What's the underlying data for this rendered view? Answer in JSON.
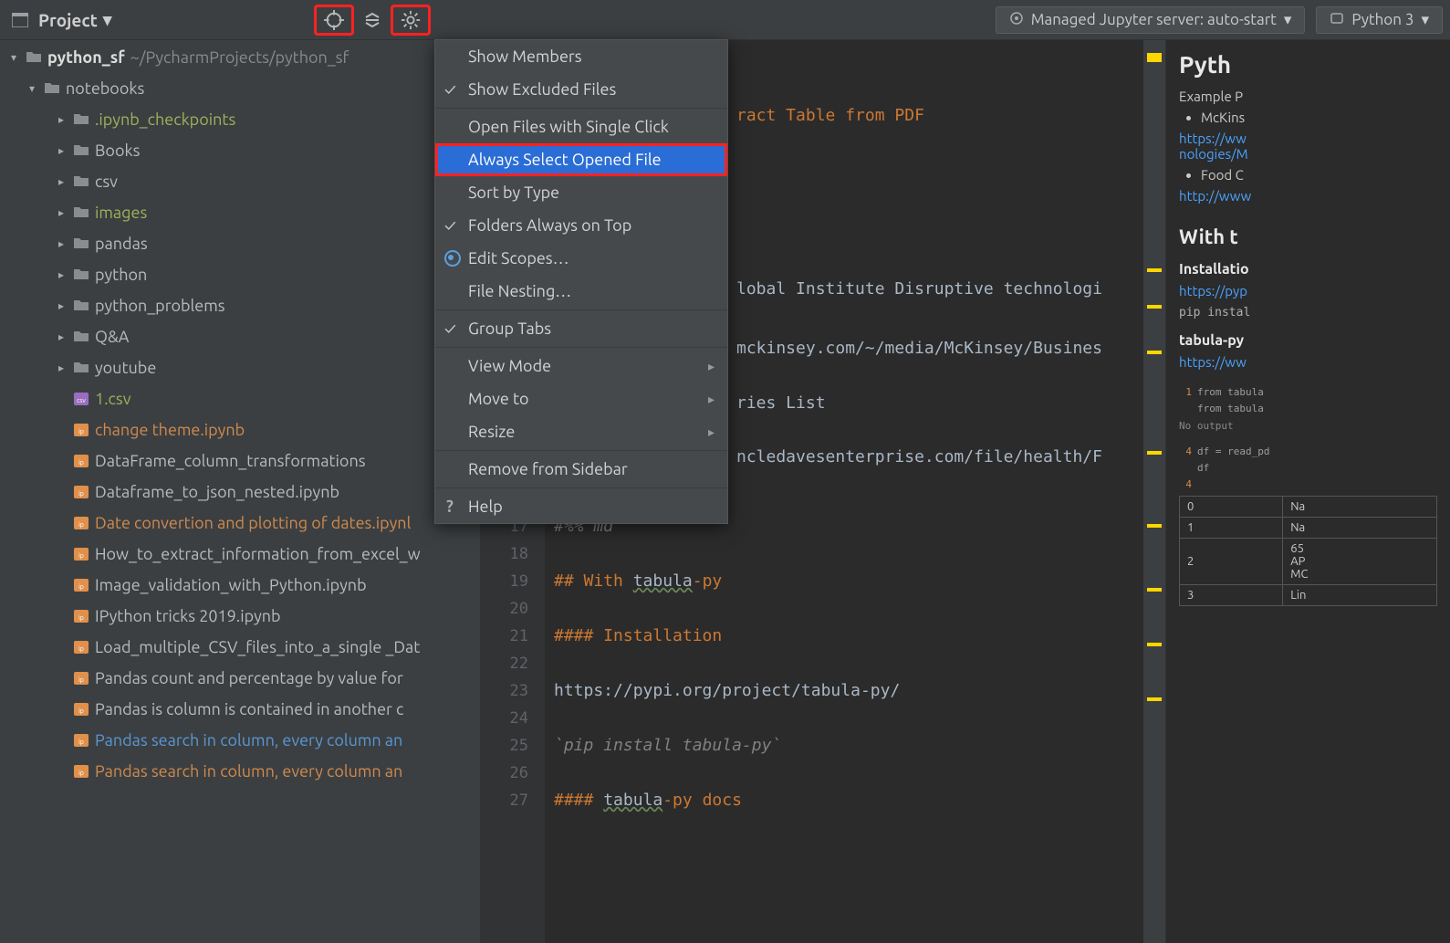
{
  "toolbar": {
    "project_label": "Project",
    "jupyter_label": "Managed Jupyter server: auto-start",
    "python_label": "Python 3"
  },
  "project_root": {
    "name": "python_sf",
    "path": "~/PycharmProjects/python_sf"
  },
  "folders": {
    "notebooks": "notebooks",
    "ipynb_checkpoints": ".ipynb_checkpoints",
    "books": "Books",
    "csv": "csv",
    "images": "images",
    "pandas": "pandas",
    "python": "python",
    "python_problems": "python_problems",
    "qa": "Q&A",
    "youtube": "youtube"
  },
  "files": {
    "f1": "1.csv",
    "f2": "change theme.ipynb",
    "f3": "DataFrame_column_transformations",
    "f4": "Dataframe_to_json_nested.ipynb",
    "f5": "Date convertion and plotting of dates.ipynl",
    "f6": "How_to_extract_information_from_excel_w",
    "f7": "Image_validation_with_Python.ipynb",
    "f8": "IPython tricks 2019.ipynb",
    "f9": "Load_multiple_CSV_files_into_a_single _Dat",
    "f10": "Pandas count and percentage by value for",
    "f11": "Pandas is column is contained in another c",
    "f12": "Pandas search in column, every column an",
    "f13": "Pandas search in column, every column an"
  },
  "menu": {
    "show_members": "Show Members",
    "show_excluded": "Show Excluded Files",
    "open_single": "Open Files with Single Click",
    "always_select": "Always Select Opened File",
    "sort_by_type": "Sort by Type",
    "folders_top": "Folders Always on Top",
    "edit_scopes": "Edit Scopes…",
    "file_nesting": "File Nesting…",
    "group_tabs": "Group Tabs",
    "view_mode": "View Mode",
    "move_to": "Move to",
    "resize": "Resize",
    "remove_sidebar": "Remove from Sidebar",
    "help": "Help"
  },
  "editor": {
    "line_partial_1": "ract Table from PDF",
    "line_partial_2": "lobal Institute Disruptive technologi",
    "line_partial_3": "mckinsey.com/~/media/McKinsey/Busines",
    "line_partial_4": "ries List",
    "line_partial_5": "ncledavesenterprise.com/file/health/F",
    "l17": "#%% md",
    "l18": "",
    "l19_a": "## With ",
    "l19_b": "tabula",
    "l19_c": "-py",
    "l20": "",
    "l21": "#### Installation",
    "l22": "",
    "l23": "https://pypi.org/project/tabula-py/",
    "l24": "",
    "l25": "`pip install tabula-py`",
    "l26": "",
    "l27_a": "#### ",
    "l27_b": "tabula",
    "l27_c": "-py docs"
  },
  "gutter": {
    "n17": "17",
    "n18": "18",
    "n19": "19",
    "n20": "20",
    "n21": "21",
    "n22": "22",
    "n23": "23",
    "n24": "24",
    "n25": "25",
    "n26": "26",
    "n27": "27"
  },
  "right": {
    "h1": "Pyth",
    "example_label": "Example P",
    "bullet1": "McKins",
    "link1": "https://ww",
    "link1b": "nologies/M",
    "bullet2": "Food C",
    "link2": "http://www",
    "h2": "With t",
    "h4a": "Installatio",
    "link3": "https://pyp",
    "pip": "pip instal",
    "h4b": "tabula-py",
    "link4": "https://ww",
    "code1": "from tabula",
    "code2": "from tabula",
    "nooutput": "No output",
    "code3": "df = read_pd",
    "code4": "df",
    "cellnum1": "1",
    "cellnum4": "4",
    "cellnum4b": "4",
    "th0": "0",
    "th1": "Na",
    "th2": "1",
    "th3": "Na",
    "th4": "2",
    "th5a": "65",
    "th5b": "AP",
    "th5c": "MC",
    "th6": "3",
    "th7": "Lin"
  }
}
